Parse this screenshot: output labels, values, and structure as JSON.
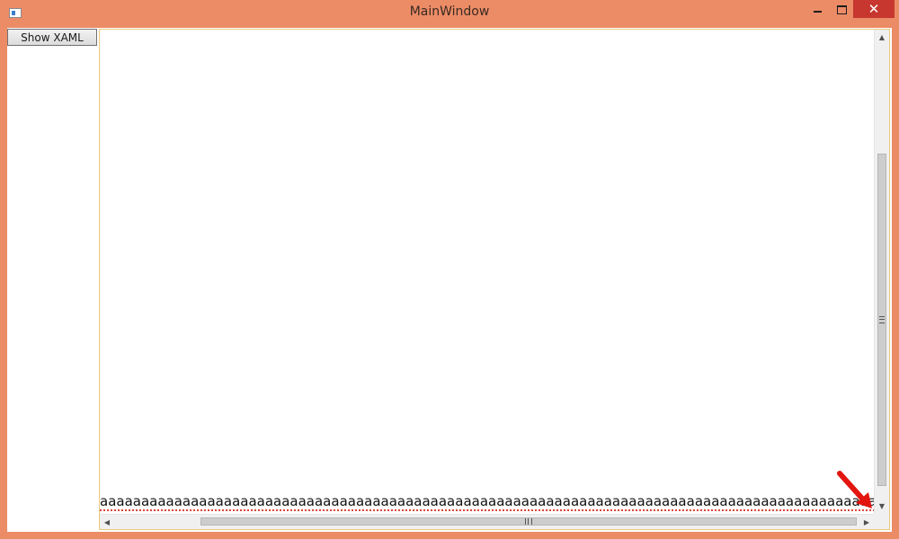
{
  "window": {
    "title": "MainWindow",
    "close_glyph": "✕"
  },
  "toolbar": {
    "show_xaml_label": "Show XAML"
  },
  "editor": {
    "text": "aaaaaaaaaaaaaaaaaaaaaaaaaaaaaaaaaaaaaaaaaaaaaaaaaaaaaaaaaaaaaaaaaaaaaaaaaaaaaaaaaaaaaaaaaaaaaaaa"
  },
  "colors": {
    "window_frame": "#ec8c66",
    "close_button": "#c7372f",
    "editor_border": "#e9c97b",
    "annotation_arrow": "#e3150f"
  },
  "icons": {
    "app": "window-app-icon",
    "minimize": "minimize-icon",
    "maximize": "maximize-icon",
    "close": "close-icon",
    "annotation": "red-arrow-annotation"
  }
}
